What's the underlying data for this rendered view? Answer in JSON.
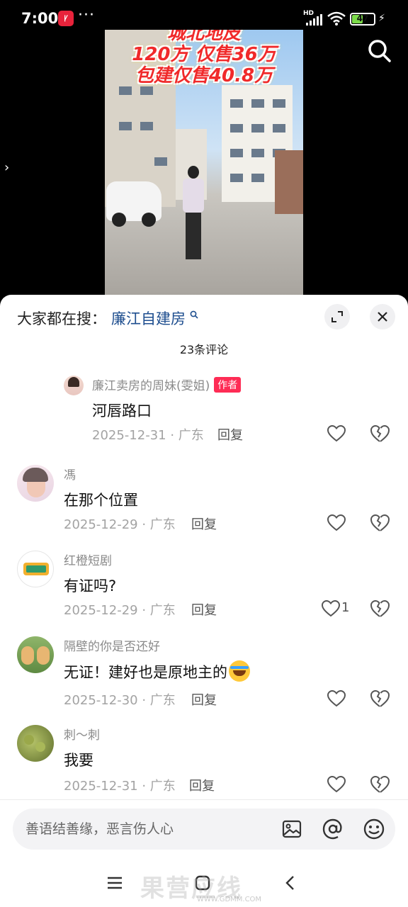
{
  "status_bar": {
    "time": "7:00",
    "app_badge": "Ꝩ",
    "more": "···",
    "network": "HD",
    "battery": "47"
  },
  "video": {
    "caption_lines": [
      "城北地皮",
      "120方 仅售36万",
      "包建仅售40.8万"
    ]
  },
  "sheet": {
    "hot_search_prefix": "大家都在搜：",
    "hot_search_query": "廉江自建房",
    "comment_count": "23条评论"
  },
  "comments": [
    {
      "user": "廉江卖房的周妹(雯姐)",
      "author_tag": "作者",
      "text": "河唇路口",
      "date": "2025-12-31",
      "location": "广东",
      "reply": "回复",
      "likes": ""
    },
    {
      "user": "馮",
      "text": "在那个位置",
      "date": "2025-12-29",
      "location": "广东",
      "reply": "回复",
      "likes": ""
    },
    {
      "user": "红橙短剧",
      "text": "有证吗?",
      "date": "2025-12-29",
      "location": "广东",
      "reply": "回复",
      "likes": "1"
    },
    {
      "user": "隔壁的你是否还好",
      "text": "无证！建好也是原地主的",
      "date": "2025-12-30",
      "location": "广东",
      "reply": "回复",
      "likes": ""
    },
    {
      "user": "刺～刺",
      "text": "我要",
      "date": "2025-12-31",
      "location": "广东",
      "reply": "回复",
      "likes": ""
    }
  ],
  "input": {
    "placeholder": "善语结善缘，恶言伤人心"
  },
  "watermark": {
    "text": "果营应线",
    "url": "WWW.GDMM.COM"
  },
  "colors": {
    "accent": "#fe2c55",
    "link": "#1e4e8f",
    "meta_gray": "#a3a3a3"
  }
}
